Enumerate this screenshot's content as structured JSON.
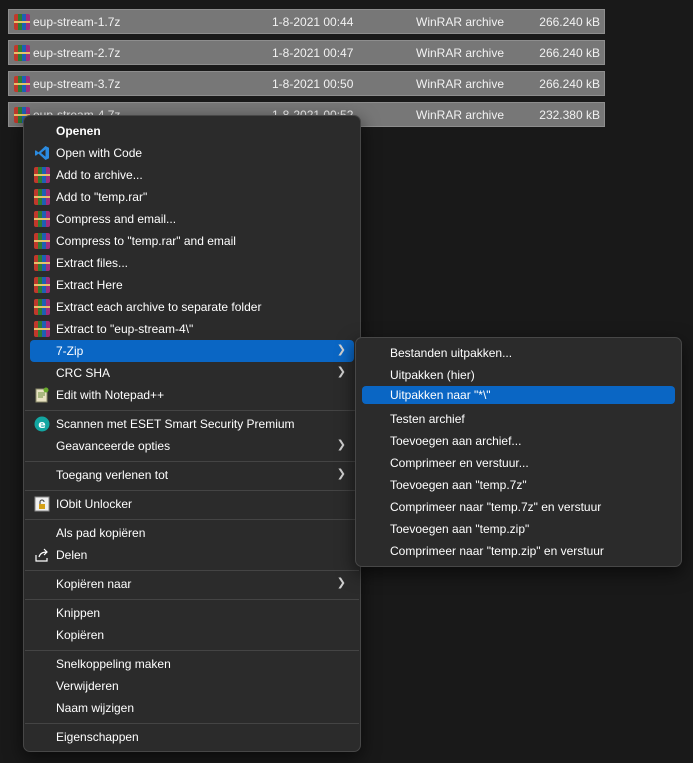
{
  "files": [
    {
      "name": "eup-stream-1.7z",
      "date": "1-8-2021 00:44",
      "type": "WinRAR archive",
      "size": "266.240 kB"
    },
    {
      "name": "eup-stream-2.7z",
      "date": "1-8-2021 00:47",
      "type": "WinRAR archive",
      "size": "266.240 kB"
    },
    {
      "name": "eup-stream-3.7z",
      "date": "1-8-2021 00:50",
      "type": "WinRAR archive",
      "size": "266.240 kB"
    },
    {
      "name": "eup-stream-4.7z",
      "date": "1-8-2021 00:52",
      "type": "WinRAR archive",
      "size": "232.380 kB"
    }
  ],
  "context_menu": {
    "items": [
      {
        "label": "Openen",
        "icon": "none"
      },
      {
        "label": "Open with Code",
        "icon": "vscode-icon"
      },
      {
        "label": "Add to archive...",
        "icon": "winrar-icon"
      },
      {
        "label": "Add to \"temp.rar\"",
        "icon": "winrar-icon"
      },
      {
        "label": "Compress and email...",
        "icon": "winrar-icon"
      },
      {
        "label": "Compress to \"temp.rar\" and email",
        "icon": "winrar-icon"
      },
      {
        "label": "Extract files...",
        "icon": "winrar-icon"
      },
      {
        "label": "Extract Here",
        "icon": "winrar-icon"
      },
      {
        "label": "Extract each archive to separate folder",
        "icon": "winrar-icon"
      },
      {
        "label": "Extract to \"eup-stream-4\\\"",
        "icon": "winrar-icon"
      },
      {
        "label": "7-Zip",
        "icon": "none"
      },
      {
        "label": "CRC SHA",
        "icon": "none"
      },
      {
        "label": "Edit with Notepad++",
        "icon": "notepad-plus-icon"
      },
      {
        "label": "Scannen met ESET Smart Security Premium",
        "icon": "eset-icon"
      },
      {
        "label": "Geavanceerde opties",
        "icon": "none"
      },
      {
        "label": "Toegang verlenen tot",
        "icon": "none"
      },
      {
        "label": "IObit Unlocker",
        "icon": "iobit-unlocker-icon"
      },
      {
        "label": "Als pad kopiëren",
        "icon": "none"
      },
      {
        "label": "Delen",
        "icon": "share-icon"
      },
      {
        "label": "Kopiëren naar",
        "icon": "none"
      },
      {
        "label": "Knippen",
        "icon": "none"
      },
      {
        "label": "Kopiëren",
        "icon": "none"
      },
      {
        "label": "Snelkoppeling maken",
        "icon": "none"
      },
      {
        "label": "Verwijderen",
        "icon": "none"
      },
      {
        "label": "Naam wijzigen",
        "icon": "none"
      },
      {
        "label": "Eigenschappen",
        "icon": "none"
      }
    ]
  },
  "submenu_7zip": {
    "items": [
      {
        "label": "Bestanden uitpakken..."
      },
      {
        "label": "Uitpakken (hier)"
      },
      {
        "label": "Uitpakken naar \"*\\\""
      },
      {
        "label": "Testen archief"
      },
      {
        "label": "Toevoegen aan archief..."
      },
      {
        "label": "Comprimeer en verstuur..."
      },
      {
        "label": "Toevoegen aan \"temp.7z\""
      },
      {
        "label": "Comprimeer naar \"temp.7z\" en verstuur"
      },
      {
        "label": "Toevoegen aan \"temp.zip\""
      },
      {
        "label": "Comprimeer naar \"temp.zip\" en verstuur"
      }
    ]
  },
  "colors": {
    "highlight": "#0a66c4",
    "menu_bg": "#2b2b2b",
    "selected_row": "#777777"
  }
}
